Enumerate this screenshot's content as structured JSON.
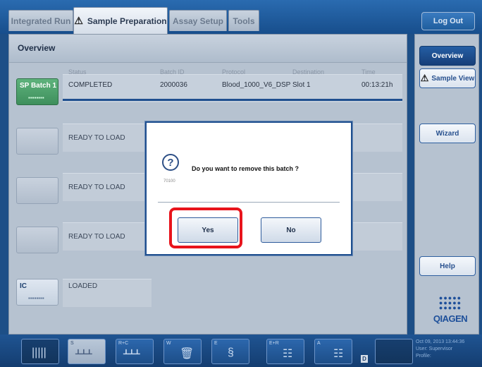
{
  "tabs": [
    {
      "label": "Integrated Run"
    },
    {
      "label": "Sample Preparation",
      "warning_icon": "warning-triangle-icon"
    },
    {
      "label": "Assay Setup"
    },
    {
      "label": "Tools"
    }
  ],
  "header": {
    "logout_label": "Log Out"
  },
  "overview": {
    "title": "Overview",
    "columns": [
      "Status",
      "Batch ID",
      "Protocol",
      "Destination",
      "Time"
    ],
    "rows": [
      {
        "batch_label": "SP Batch 1",
        "status": "COMPLETED",
        "batch_id": "2000036",
        "protocol": "Blood_1000_V6_DSP",
        "destination": "Slot 1",
        "time": "00:13:21h"
      },
      {
        "status": "READY TO LOAD"
      },
      {
        "status": "READY TO LOAD"
      },
      {
        "status": "READY TO LOAD"
      },
      {
        "batch_label": "IC",
        "status": "LOADED"
      }
    ]
  },
  "sidebar": {
    "overview_label": "Overview",
    "sample_view_label": "Sample View",
    "wizard_label": "Wizard",
    "help_label": "Help",
    "logo_text": "QIAGEN"
  },
  "dialog": {
    "message": "Do you want to remove this batch ?",
    "code": "70100",
    "yes_label": "Yes",
    "no_label": "No"
  },
  "bottom": {
    "slots": [
      "S",
      "R+C",
      "W",
      "E",
      "E+R",
      "A"
    ],
    "d_label": "D",
    "status_lines": [
      "Oct 09, 2013 13:44:36",
      "User:     Supervisor",
      "Profile:"
    ]
  },
  "colors": {
    "accent": "#1f4f8f",
    "highlight": "#e8141c",
    "batch_green": "#4ea06b"
  }
}
